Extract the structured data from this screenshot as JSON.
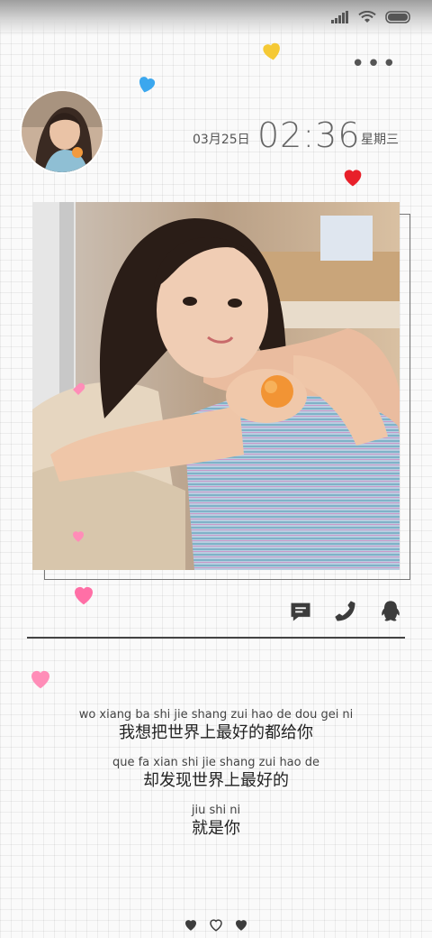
{
  "clock": {
    "date": "03月25日",
    "time": "02:36",
    "weekday": "星期三"
  },
  "lyrics": [
    {
      "pinyin": "wo xiang ba shi jie shang zui hao de dou gei ni",
      "hanzi": "我想把世界上最好的都给你"
    },
    {
      "pinyin": "que fa xian shi jie shang zui hao de",
      "hanzi": "却发现世界上最好的"
    },
    {
      "pinyin": "jiu shi ni",
      "hanzi": "就是你"
    }
  ],
  "icons": {
    "status": [
      "signal-icon",
      "wifi-icon",
      "battery-icon"
    ],
    "actions": [
      "message-icon",
      "phone-icon",
      "qq-icon"
    ],
    "bottom": [
      "heart-filled-icon",
      "heart-outline-icon",
      "heart-filled-icon"
    ]
  },
  "colors": {
    "heart_pink": "#ff7eb0",
    "heart_red": "#e8202a",
    "heart_yellow": "#f5c935",
    "heart_blue": "#3ba7ee",
    "icon_dark": "#3c3c3c"
  }
}
